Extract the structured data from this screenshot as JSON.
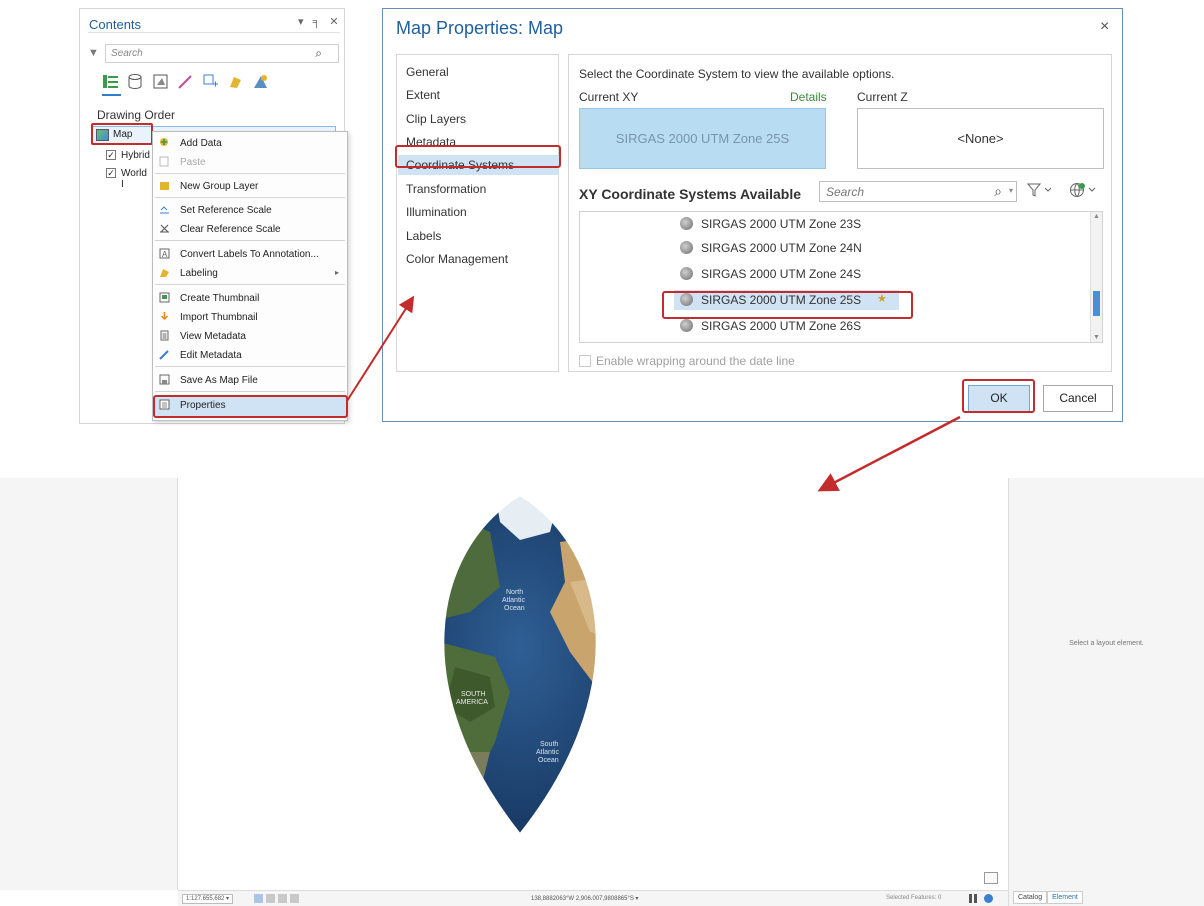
{
  "contents": {
    "title": "Contents",
    "pane_controls": "▾ ╕ ✕",
    "search_placeholder": "Search",
    "drawing_order": "Drawing Order",
    "map_label": "Map",
    "layers": [
      {
        "label": "Hybrid",
        "checked": true
      },
      {
        "label": "World I",
        "checked": true
      }
    ],
    "toolbar_icons": [
      "list-by-drawing-order-icon",
      "list-by-source-icon",
      "list-by-selection-icon",
      "list-by-editing-icon",
      "list-by-snapping-icon",
      "list-by-labeling-icon",
      "list-by-perspective-icon"
    ]
  },
  "context_menu": {
    "items": [
      {
        "label": "Add Data",
        "icon": "add-data-icon",
        "disabled": false
      },
      {
        "label": "Paste",
        "icon": "paste-icon",
        "disabled": true
      },
      {
        "label": "New Group Layer",
        "icon": "group-layer-icon",
        "disabled": false
      },
      {
        "label": "Set Reference Scale",
        "icon": "set-scale-icon",
        "disabled": false
      },
      {
        "label": "Clear Reference Scale",
        "icon": "clear-scale-icon",
        "disabled": false
      },
      {
        "label": "Convert Labels To Annotation...",
        "icon": "convert-labels-icon",
        "disabled": false
      },
      {
        "label": "Labeling",
        "icon": "labeling-icon",
        "disabled": false,
        "submenu": true
      },
      {
        "label": "Create Thumbnail",
        "icon": "thumbnail-icon",
        "disabled": false
      },
      {
        "label": "Import Thumbnail",
        "icon": "import-thumbnail-icon",
        "disabled": false
      },
      {
        "label": "View Metadata",
        "icon": "view-metadata-icon",
        "disabled": false
      },
      {
        "label": "Edit Metadata",
        "icon": "edit-metadata-icon",
        "disabled": false
      },
      {
        "label": "Save As Map File",
        "icon": "save-map-file-icon",
        "disabled": false
      },
      {
        "label": "Properties",
        "icon": "properties-icon",
        "disabled": false,
        "selected": true
      }
    ]
  },
  "dialog": {
    "title": "Map Properties: Map",
    "close": "×",
    "nav": [
      "General",
      "Extent",
      "Clip Layers",
      "Metadata",
      "Coordinate Systems",
      "Transformation",
      "Illumination",
      "Labels",
      "Color Management"
    ],
    "nav_selected": "Coordinate Systems",
    "instruction": "Select the Coordinate System to view the available options.",
    "current_xy_label": "Current XY",
    "details_link": "Details",
    "current_z_label": "Current Z",
    "current_xy_value": "SIRGAS 2000 UTM Zone 25S",
    "current_z_value": "<None>",
    "available_heading": "XY Coordinate Systems Available",
    "search_placeholder": "Search",
    "systems": [
      "SIRGAS 2000 UTM Zone 23S",
      "SIRGAS 2000 UTM Zone 24N",
      "SIRGAS 2000 UTM Zone 24S",
      "SIRGAS 2000 UTM Zone 25S",
      "SIRGAS 2000 UTM Zone 26S"
    ],
    "selected_system": "SIRGAS 2000 UTM Zone 25S",
    "wrap_label": "Enable wrapping around the date line",
    "ok_label": "OK",
    "cancel_label": "Cancel"
  },
  "layout_view": {
    "map_labels": {
      "north_atlantic": "North\nAtlantic\nOcean",
      "south_america": "SOUTH\nAMERICA",
      "south_atlantic": "South\nAtlantic\nOcean"
    },
    "right_msg": "Select a layout element.",
    "tab_catalog": "Catalog",
    "tab_element": "Element",
    "scale": "1:127,655,682",
    "coords": "138,8882063°W 2,906.007,9808865°S",
    "selected_features": "Selected Features: 0"
  },
  "colors": {
    "accent_blue": "#1f5f9e",
    "highlight_red": "#c22c2c",
    "selection_blue": "#cfe3f5"
  }
}
